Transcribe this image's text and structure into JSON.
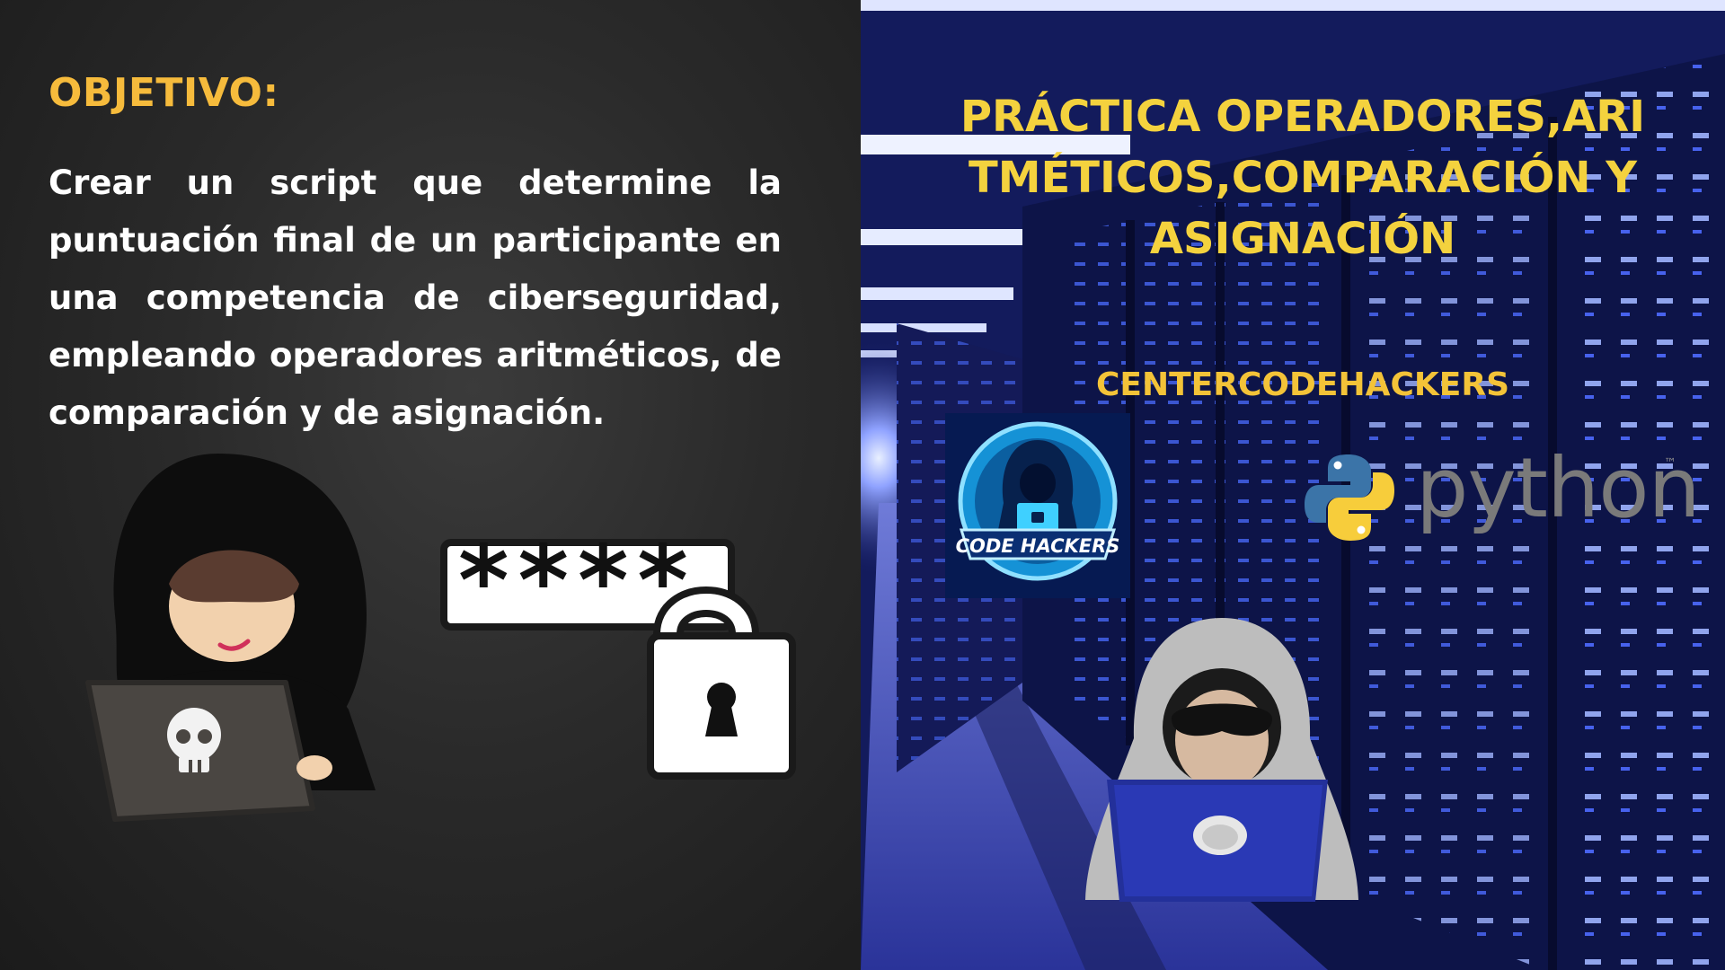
{
  "objective": {
    "heading": "OBJETIVO:",
    "body": "Crear un script que determine la puntuación final de un participante en una competencia de ciberseguridad, empleando operadores aritméticos, de comparación y de asignación."
  },
  "practice": {
    "title": "PRÁCTICA OPERADORES,ARITMÉTICOS,COMPARACIÓN Y ASIGNACIÓN",
    "organization": "CENTERCODEHACKERS"
  },
  "logo": {
    "text": "CODE HACKERS"
  },
  "python": {
    "wordmark": "python",
    "trademark": "™"
  },
  "password": {
    "masked": "****"
  },
  "colors": {
    "heading": "#f6bb3c",
    "title": "#f4d23e",
    "body_text": "#ffffff",
    "server_light": "#3b5bff"
  }
}
